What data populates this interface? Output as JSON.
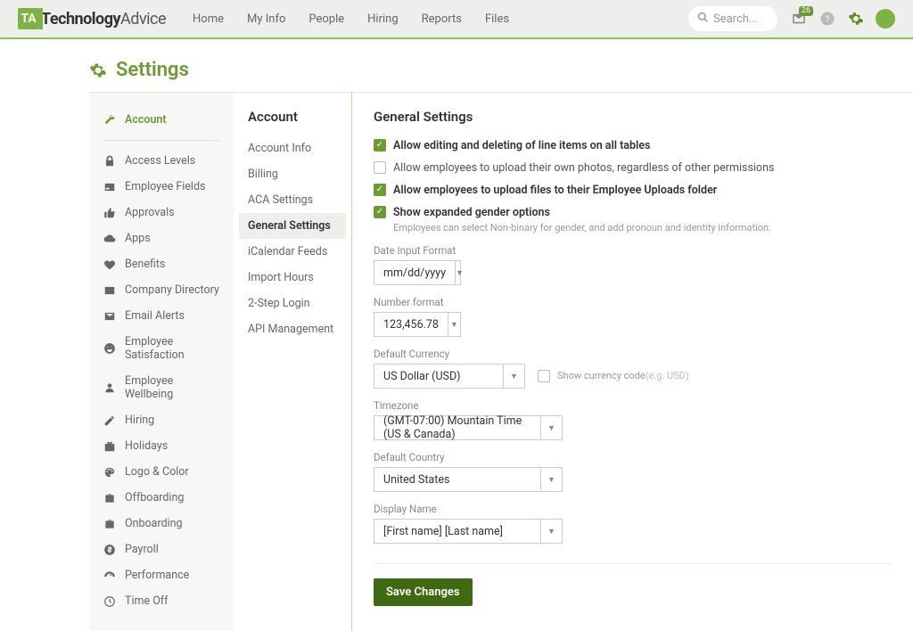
{
  "nav": {
    "brand_bold": "Technology",
    "brand_light": "Advice",
    "links": [
      "Home",
      "My Info",
      "People",
      "Hiring",
      "Reports",
      "Files"
    ],
    "search_placeholder": "Search...",
    "inbox_badge": "26"
  },
  "page_title": "Settings",
  "sidebar1": {
    "active": "Account",
    "items": [
      {
        "label": "Account",
        "icon": "wrench"
      },
      {
        "label": "Access Levels",
        "icon": "lock"
      },
      {
        "label": "Employee Fields",
        "icon": "id"
      },
      {
        "label": "Approvals",
        "icon": "thumb"
      },
      {
        "label": "Apps",
        "icon": "cloud"
      },
      {
        "label": "Benefits",
        "icon": "heart"
      },
      {
        "label": "Company Directory",
        "icon": "card"
      },
      {
        "label": "Email Alerts",
        "icon": "mail"
      },
      {
        "label": "Employee Satisfaction",
        "icon": "smile"
      },
      {
        "label": "Employee Wellbeing",
        "icon": "person"
      },
      {
        "label": "Hiring",
        "icon": "edit"
      },
      {
        "label": "Holidays",
        "icon": "gift"
      },
      {
        "label": "Logo & Color",
        "icon": "palette"
      },
      {
        "label": "Offboarding",
        "icon": "briefcase"
      },
      {
        "label": "Onboarding",
        "icon": "briefcase"
      },
      {
        "label": "Payroll",
        "icon": "dollar"
      },
      {
        "label": "Performance",
        "icon": "meter"
      },
      {
        "label": "Time Off",
        "icon": "clock"
      }
    ]
  },
  "sidebar2": {
    "title": "Account",
    "items": [
      "Account Info",
      "Billing",
      "ACA Settings",
      "General Settings",
      "iCalendar Feeds",
      "Import Hours",
      "2-Step Login",
      "API Management"
    ],
    "active": "General Settings"
  },
  "main": {
    "title": "General Settings",
    "checks": [
      {
        "checked": true,
        "label": "Allow editing and deleting of line items on all tables"
      },
      {
        "checked": false,
        "label": "Allow employees to upload their own photos, regardless of other permissions",
        "light": true
      },
      {
        "checked": true,
        "label": "Allow employees to upload files to their Employee Uploads folder"
      },
      {
        "checked": true,
        "label": "Show expanded gender options",
        "sub": "Employees can select Non-binary for gender, and add pronoun and identity information."
      }
    ],
    "date_format": {
      "label": "Date Input Format",
      "value": "mm/dd/yyyy"
    },
    "number_format": {
      "label": "Number format",
      "value": "123,456.78"
    },
    "currency": {
      "label": "Default Currency",
      "value": "US Dollar (USD)",
      "show_code_label": "Show currency code",
      "show_code_hint": "(e.g. USD)"
    },
    "timezone": {
      "label": "Timezone",
      "value": "(GMT-07:00) Mountain Time (US & Canada)"
    },
    "country": {
      "label": "Default Country",
      "value": "United States"
    },
    "display_name": {
      "label": "Display Name",
      "value": "[First name] [Last name]"
    },
    "save": "Save Changes"
  }
}
